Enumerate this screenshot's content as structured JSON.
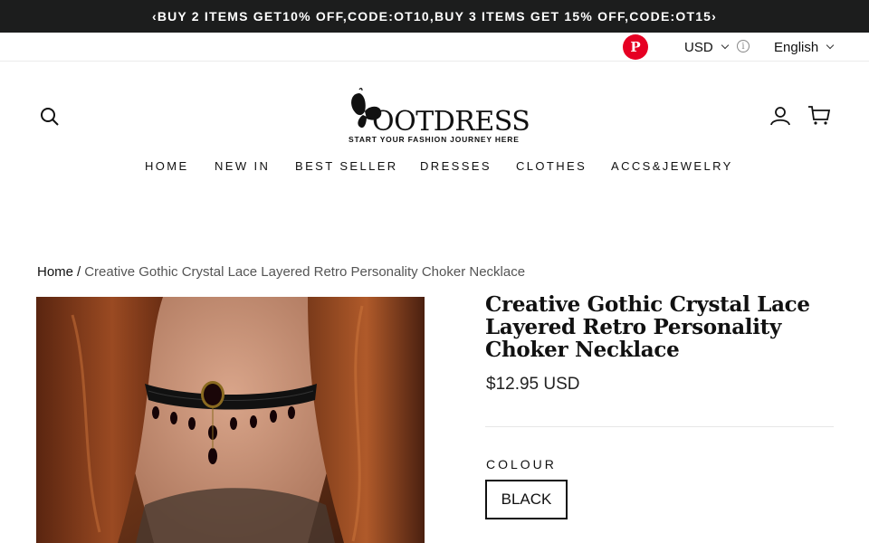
{
  "announcement": "‹BUY 2 ITEMS GET10% OFF,CODE:OT10,BUY 3 ITEMS GET 15% OFF,CODE:OT15›",
  "toolbar": {
    "pinterest_glyph": "P",
    "currency": "USD",
    "info_glyph": "i",
    "language": "English"
  },
  "header": {
    "logo_text": "OOTDRESS",
    "logo_tagline": "START YOUR FASHION JOURNEY HERE",
    "icons": [
      "search-icon",
      "user-icon",
      "cart-icon"
    ]
  },
  "nav": {
    "items": [
      "HOME",
      "NEW IN",
      "BEST SELLER",
      "DRESSES",
      "CLOTHES",
      "ACCS&JEWELRY"
    ]
  },
  "breadcrumb": {
    "home": "Home",
    "separator": "/",
    "current": "Creative Gothic Crystal Lace Layered Retro Personality Choker Necklace"
  },
  "product": {
    "title": "Creative Gothic Crystal Lace Layered Retro Personality Choker Necklace",
    "price": "$12.95 USD",
    "option_label": "COLOUR",
    "option_value": "BLACK"
  },
  "colors": {
    "announcement_bg": "#1c1d1d",
    "pinterest": "#e60023"
  }
}
